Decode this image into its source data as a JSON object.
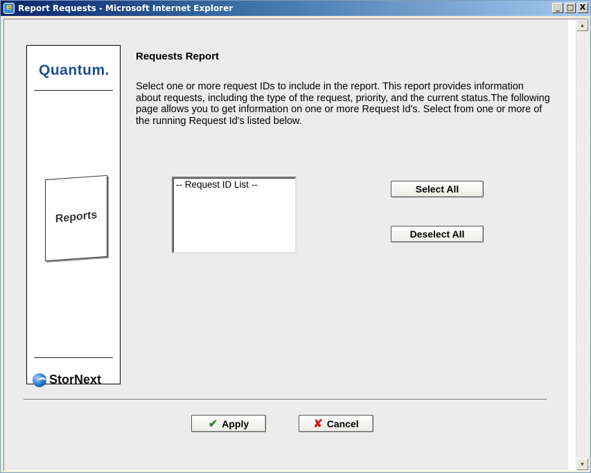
{
  "window": {
    "title": "Report Requests - Microsoft Internet Explorer",
    "minimize_label": "_",
    "maximize_label": "□",
    "close_label": "X"
  },
  "branding": {
    "quantum_logo": "Quantum.",
    "reports_card_label": "Reports",
    "stornext_logo": "StorNext"
  },
  "main": {
    "heading": "Requests Report",
    "description": "Select one or more request IDs to include in the report. This report provides information about requests, including the type of the request, priority, and the current status.The following page allows you to get information on one or more Request Id's. Select from one or more of the running Request Id's listed below.",
    "request_list": {
      "options": [
        "-- Request ID List --"
      ]
    },
    "select_all_label": "Select All",
    "deselect_all_label": "Deselect All"
  },
  "footer": {
    "apply_label": "Apply",
    "cancel_label": "Cancel"
  },
  "icons": {
    "apply": "check-icon",
    "cancel": "x-icon",
    "browser": "ie-icon"
  },
  "colors": {
    "titlebar_start": "#0a246a",
    "quantum_brand": "#1d4f91",
    "apply_check": "#2a8a2a",
    "cancel_x": "#d01818"
  }
}
